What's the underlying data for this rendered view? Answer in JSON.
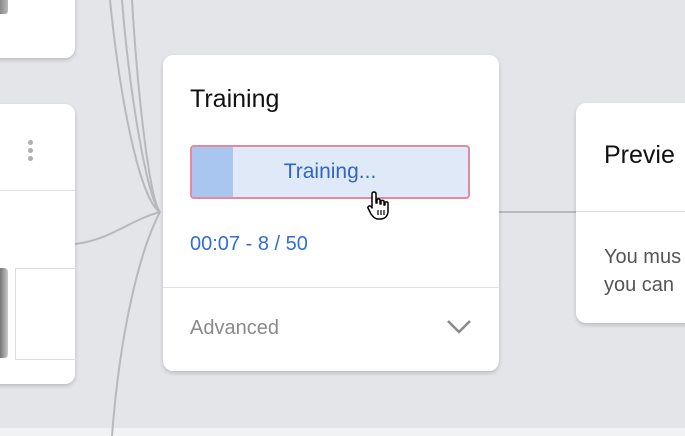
{
  "training_card": {
    "title": "Training",
    "button_label": "Training...",
    "progress_fraction": 0.15,
    "status_text": "00:07 - 8 / 50",
    "advanced_label": "Advanced"
  },
  "preview_card": {
    "title": "Previe",
    "text_line1": "You mus",
    "text_line2": "you can"
  },
  "colors": {
    "accent_blue": "#2f6fd6",
    "button_fill": "#dfe9f8",
    "progress_fill": "#a9c6f1",
    "button_border": "#e58a9a"
  },
  "icons": [
    "kebab-menu-icon",
    "chevron-down-icon",
    "hand-pointer-cursor-icon"
  ]
}
